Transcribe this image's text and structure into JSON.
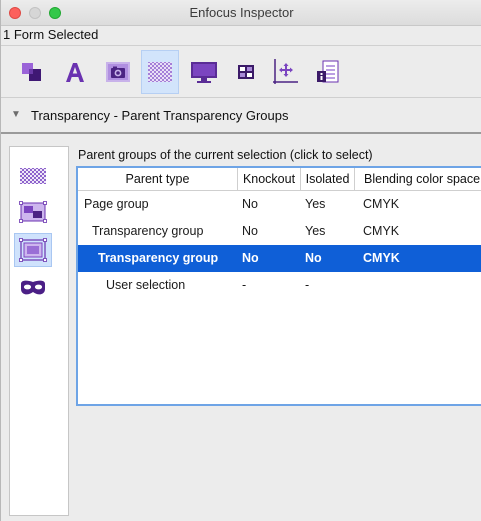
{
  "window": {
    "title": "Enfocus Inspector"
  },
  "selection_info": "1 Form Selected",
  "toolbar": {
    "tools": [
      {
        "icon": "objects-icon"
      },
      {
        "icon": "text-icon"
      },
      {
        "icon": "image-icon"
      },
      {
        "icon": "transparency-icon",
        "active": true
      },
      {
        "icon": "monitor-icon"
      },
      {
        "icon": "color-swatch-icon"
      },
      {
        "icon": "position-icon"
      },
      {
        "icon": "document-info-icon"
      }
    ]
  },
  "section": {
    "title": "Transparency - Parent Transparency Groups",
    "expanded": true
  },
  "left_tabs": [
    {
      "icon": "transparency-checker-icon"
    },
    {
      "icon": "group-icon"
    },
    {
      "icon": "selection-group-icon",
      "active": true
    },
    {
      "icon": "mask-icon"
    }
  ],
  "caption": "Parent groups of the current selection (click to select)",
  "table": {
    "headers": [
      "Parent type",
      "Knockout",
      "Isolated",
      "Blending color space"
    ],
    "rows": [
      {
        "type": "Page group",
        "knockout": "No",
        "isolated": "Yes",
        "blending": "CMYK",
        "indent": 0
      },
      {
        "type": "Transparency group",
        "knockout": "No",
        "isolated": "Yes",
        "blending": "CMYK",
        "indent": 1
      },
      {
        "type": "Transparency group",
        "knockout": "No",
        "isolated": "No",
        "blending": "CMYK",
        "indent": 2,
        "selected": true
      },
      {
        "type": "User selection",
        "knockout": "-",
        "isolated": "-",
        "blending": "",
        "indent": 3
      }
    ]
  },
  "colors": {
    "selection": "#0f5fd7",
    "accent_purple": "#7b3ab8",
    "focus_border": "#6ea4e6"
  }
}
